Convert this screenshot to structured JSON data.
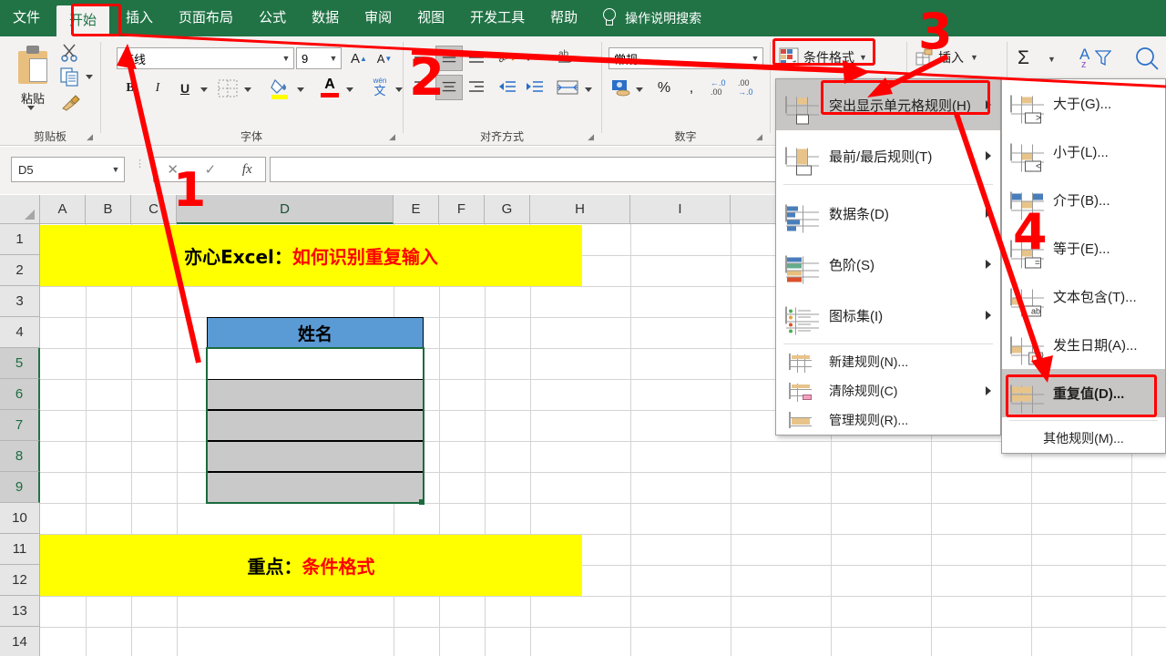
{
  "ribbon": {
    "tabs": [
      {
        "label": "文件",
        "active": false
      },
      {
        "label": "开始",
        "active": true
      },
      {
        "label": "插入",
        "active": false
      },
      {
        "label": "页面布局",
        "active": false
      },
      {
        "label": "公式",
        "active": false
      },
      {
        "label": "数据",
        "active": false
      },
      {
        "label": "审阅",
        "active": false
      },
      {
        "label": "视图",
        "active": false
      },
      {
        "label": "开发工具",
        "active": false
      },
      {
        "label": "帮助",
        "active": false
      }
    ],
    "tell_me": "操作说明搜索",
    "groups": {
      "clipboard": {
        "label": "剪贴板",
        "paste_label": "粘贴"
      },
      "font": {
        "label": "字体",
        "font_name": "等线",
        "font_size": "9",
        "bold": "B",
        "italic": "I",
        "underline": "U",
        "grow_font": "A",
        "shrink_font": "A",
        "phonetic": "文"
      },
      "alignment": {
        "label": "对齐方式"
      },
      "number": {
        "label": "数字",
        "format": "常规",
        "percent": "%",
        "comma": ","
      },
      "styles": {
        "conditional_format": "条件格式"
      },
      "cells": {
        "insert": "插入"
      },
      "editing": {
        "autosum": "Σ",
        "sort_filter": "A"
      }
    }
  },
  "formula_bar": {
    "name_box": "D5",
    "cancel": "✕",
    "enter": "✓",
    "fx": "fx",
    "value": ""
  },
  "sheet": {
    "columns": [
      "A",
      "B",
      "C",
      "D",
      "E",
      "F",
      "G",
      "H",
      "I"
    ],
    "active_column": "D",
    "rows": [
      "1",
      "2",
      "3",
      "4",
      "5",
      "6",
      "7",
      "8",
      "9",
      "10",
      "11",
      "12",
      "13",
      "14"
    ],
    "selected_rows": [
      "5",
      "6",
      "7",
      "8",
      "9"
    ],
    "banner_top": {
      "black": "亦心Excel：",
      "red": "如何识别重复输入"
    },
    "banner_bottom": {
      "black": "重点：",
      "red": "条件格式"
    },
    "table_header": "姓名",
    "selection_range": "D5:D9"
  },
  "cf_menu": {
    "items": [
      {
        "label": "突出显示单元格规则(H)",
        "icon": "highlight-cell-rules-icon",
        "submenu": true,
        "highlighted": true
      },
      {
        "label": "最前/最后规则(T)",
        "icon": "top-bottom-rules-icon",
        "submenu": true,
        "highlighted": false
      },
      {
        "label": "数据条(D)",
        "icon": "data-bars-icon",
        "submenu": true,
        "highlighted": false
      },
      {
        "label": "色阶(S)",
        "icon": "color-scales-icon",
        "submenu": true,
        "highlighted": false
      },
      {
        "label": "图标集(I)",
        "icon": "icon-sets-icon",
        "submenu": true,
        "highlighted": false
      }
    ],
    "footer_items": [
      {
        "label": "新建规则(N)...",
        "icon": "new-rule-icon",
        "submenu": false
      },
      {
        "label": "清除规则(C)",
        "icon": "clear-rules-icon",
        "submenu": true
      },
      {
        "label": "管理规则(R)...",
        "icon": "manage-rules-icon",
        "submenu": false
      }
    ]
  },
  "cf_submenu": {
    "items": [
      {
        "label": "大于(G)...",
        "icon": "greater-than-icon",
        "highlighted": false
      },
      {
        "label": "小于(L)...",
        "icon": "less-than-icon",
        "highlighted": false
      },
      {
        "label": "介于(B)...",
        "icon": "between-icon",
        "highlighted": false
      },
      {
        "label": "等于(E)...",
        "icon": "equal-to-icon",
        "highlighted": false
      },
      {
        "label": "文本包含(T)...",
        "icon": "text-contains-icon",
        "highlighted": false
      },
      {
        "label": "发生日期(A)...",
        "icon": "date-occurring-icon",
        "highlighted": false
      },
      {
        "label": "重复值(D)...",
        "icon": "duplicate-values-icon",
        "highlighted": true
      }
    ],
    "more_rules": "其他规则(M)..."
  },
  "annotations": {
    "markers": [
      "1",
      "2",
      "3",
      "4"
    ],
    "color": "#ff0000"
  }
}
